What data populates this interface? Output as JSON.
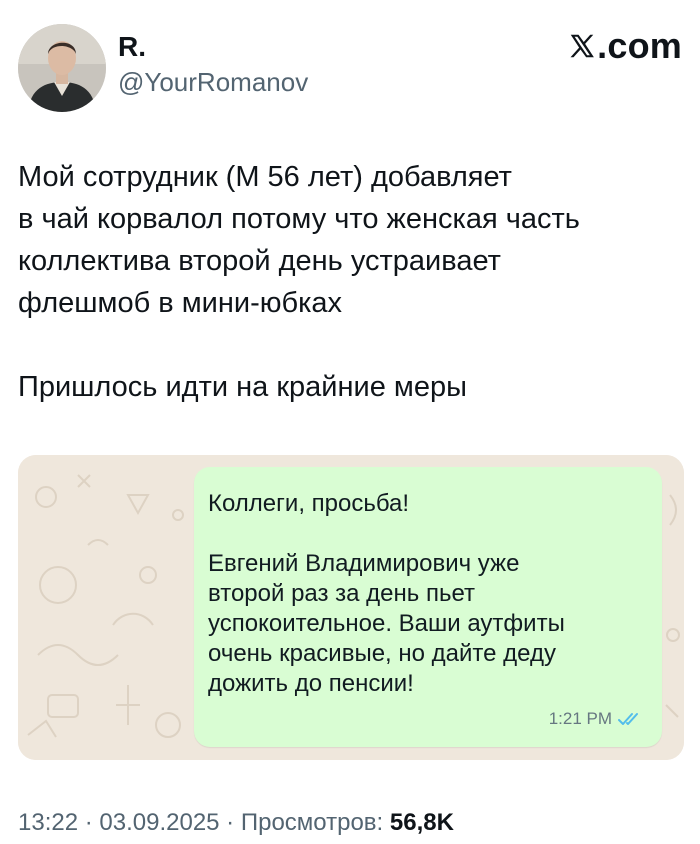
{
  "header": {
    "display_name": "R.",
    "handle": "@YourRomanov",
    "brand": ".com",
    "brand_icon": "x-logo-icon"
  },
  "tweet": {
    "text": "Мой сотрудник (М 56 лет) добавляет\nв чай корвалол потому что женская часть\nколлектива второй день устраивает\nфлешмоб в мини-юбках\n\nПришлось идти на крайние меры"
  },
  "media": {
    "message_text": "Коллеги, просьба!\n\nЕвгений Владимирович уже\nвторой раз за день пьет\nуспокоительное. Ваши аутфиты\nочень красивые, но дайте деду\nдожить до пенсии!",
    "time": "1:21 PM",
    "read_status_icon": "double-check-icon",
    "bubble_color": "#d9fdd3",
    "wallpaper_color": "#efe7dc",
    "check_color": "#53bdeb"
  },
  "footer": {
    "time": "13:22",
    "date": "03.09.2025",
    "separator": " · ",
    "views_label": "Просмотров:",
    "views_count": "56,8K"
  }
}
